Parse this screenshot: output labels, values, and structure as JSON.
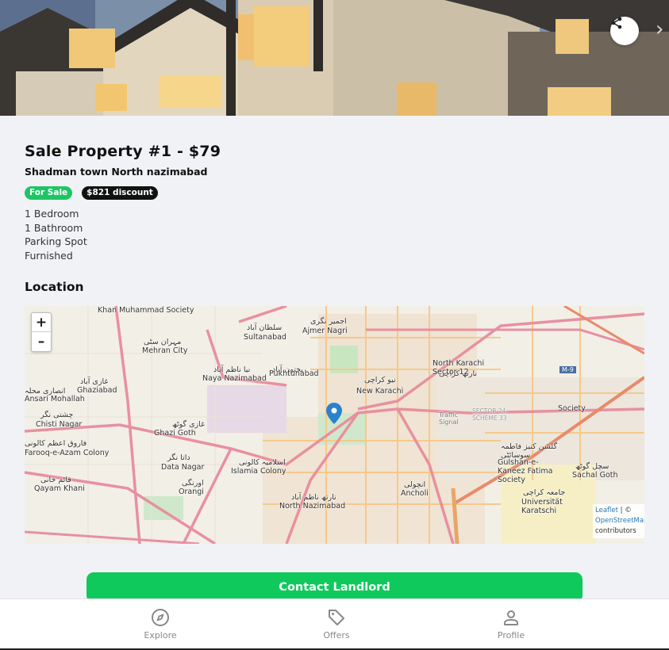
{
  "hero": {
    "share_icon": "share-icon",
    "next_icon": "chevron-right-icon",
    "next_glyph": "›"
  },
  "property": {
    "title": "Sale Property #1 - $79",
    "address": "Shadman town North nazimabad",
    "badges": [
      "For Sale",
      "$821 discount"
    ],
    "features": [
      "1 Bedroom",
      "1 Bathroom",
      "Parking Spot",
      "Furnished"
    ]
  },
  "location": {
    "heading": "Location",
    "zoom_in": "+",
    "zoom_out": "–",
    "labels": [
      "Khan Muhammad Society",
      "سلطان آباد",
      "Sultanabad",
      "اجمیر نگری",
      "Ajmer Nagri",
      "مہران سٹی",
      "Mehran City",
      "نیا ناظم آباد",
      "Naya Nazimabad",
      "پختون آباد",
      "Pukhtunabad",
      "غازی آباد",
      "Ghaziabad",
      "نیو کراچی",
      "New Karachi",
      "نارتھ کراچی",
      "North Karachi Sector 12",
      "انصاری محلہ",
      "Ansari Mohallah",
      "چشتی نگر",
      "Chisti Nagar",
      "غازی گوٹھ",
      "Ghazi Goth",
      "فاروق اعظم کالونی",
      "Farooq-e-Azam Colony",
      "داتا نگر",
      "Data Nagar",
      "اسلامیہ کالونی",
      "Islamia Colony",
      "قائم خانی",
      "Qayam Khani",
      "اورنگی",
      "Orangi",
      "نارتھ ناظم آباد",
      "North Nazimabad",
      "انچولی",
      "Ancholi",
      "گلشن کنیز فاطمہ سوسائٹی",
      "Gulshan-e-Kaneez Fatima Society",
      "سچل گوٹھ",
      "Sachal Goth",
      "جامعہ کراچی",
      "Universität Karatschi",
      "Society",
      "Traffic Signal",
      "M-9",
      "SECTOR 24, SCHEME 33"
    ],
    "attribution": {
      "leaflet": "Leaflet",
      "sep": "| ©",
      "osm": "OpenStreetMap",
      "contributors": "contributors"
    }
  },
  "cta": {
    "contact": "Contact Landlord"
  },
  "nav": {
    "items": [
      {
        "label": "Explore",
        "icon": "compass-icon"
      },
      {
        "label": "Offers",
        "icon": "tag-icon"
      },
      {
        "label": "Profile",
        "icon": "user-icon"
      }
    ]
  },
  "colors": {
    "accent": "#10c95c",
    "badge_green": "#1dc565",
    "badge_black": "#111111",
    "pin": "#2b82cb"
  }
}
